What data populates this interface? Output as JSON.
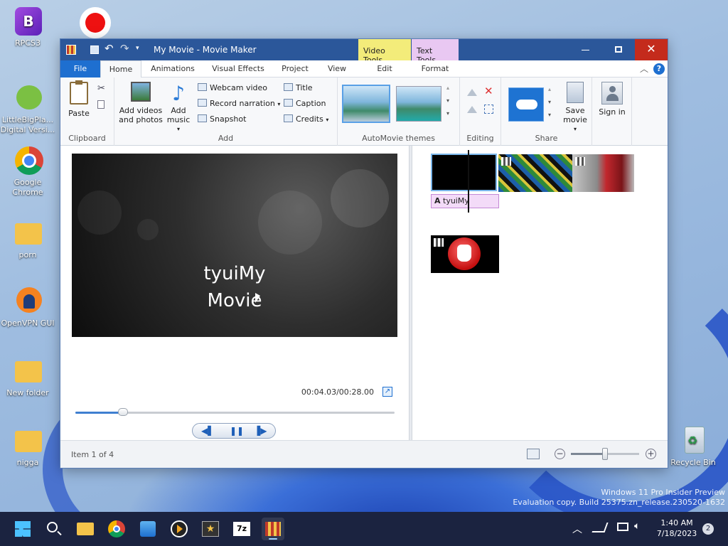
{
  "desktop": {
    "icons": [
      {
        "label": "RPCS3"
      },
      {
        "label": "LittleBigPla... Digital Versi..."
      },
      {
        "label": "Google Chrome"
      },
      {
        "label": "porn"
      },
      {
        "label": "OpenVPN GUI"
      },
      {
        "label": "New folder"
      },
      {
        "label": "nigga"
      },
      {
        "label": "Recycle Bin"
      }
    ],
    "watermark": {
      "line1": "Windows 11 Pro Insider Preview",
      "line2": "Evaluation copy. Build 25375.zn_release.230520-1632"
    }
  },
  "window": {
    "title": "My Movie - Movie Maker",
    "contextual": {
      "video_tools": "Video Tools",
      "text_tools": "Text Tools"
    },
    "tabs": [
      "File",
      "Home",
      "Animations",
      "Visual Effects",
      "Project",
      "View",
      "Edit",
      "Format"
    ],
    "ribbon": {
      "clipboard": {
        "label": "Clipboard",
        "paste": "Paste"
      },
      "add": {
        "label": "Add",
        "add_videos": "Add videos and photos",
        "add_music": "Add music",
        "webcam": "Webcam video",
        "narration": "Record narration",
        "snapshot": "Snapshot",
        "title": "Title",
        "caption": "Caption",
        "credits": "Credits"
      },
      "themes": {
        "label": "AutoMovie themes"
      },
      "editing": {
        "label": "Editing"
      },
      "share": {
        "label": "Share",
        "save_movie": "Save movie",
        "sign_in": "Sign in"
      }
    },
    "preview": {
      "overlay_text_line1": "tyuiMy",
      "overlay_text_line2": "Movie",
      "time": "00:04.03/00:28.00",
      "progress": 0.15
    },
    "storyboard": {
      "caption_label": "tyuiMy"
    },
    "status": {
      "item": "Item 1 of 4",
      "zoom": 0.5
    }
  },
  "taskbar": {
    "time": "1:40 AM",
    "date": "7/18/2023",
    "notifications": "2"
  },
  "colors": {
    "titlebar": "#2b579a",
    "file_tab": "#1e6fd0",
    "video_tools": "#f3ec7a",
    "text_tools": "#e9c8f2",
    "taskbar": "#1b2340"
  }
}
